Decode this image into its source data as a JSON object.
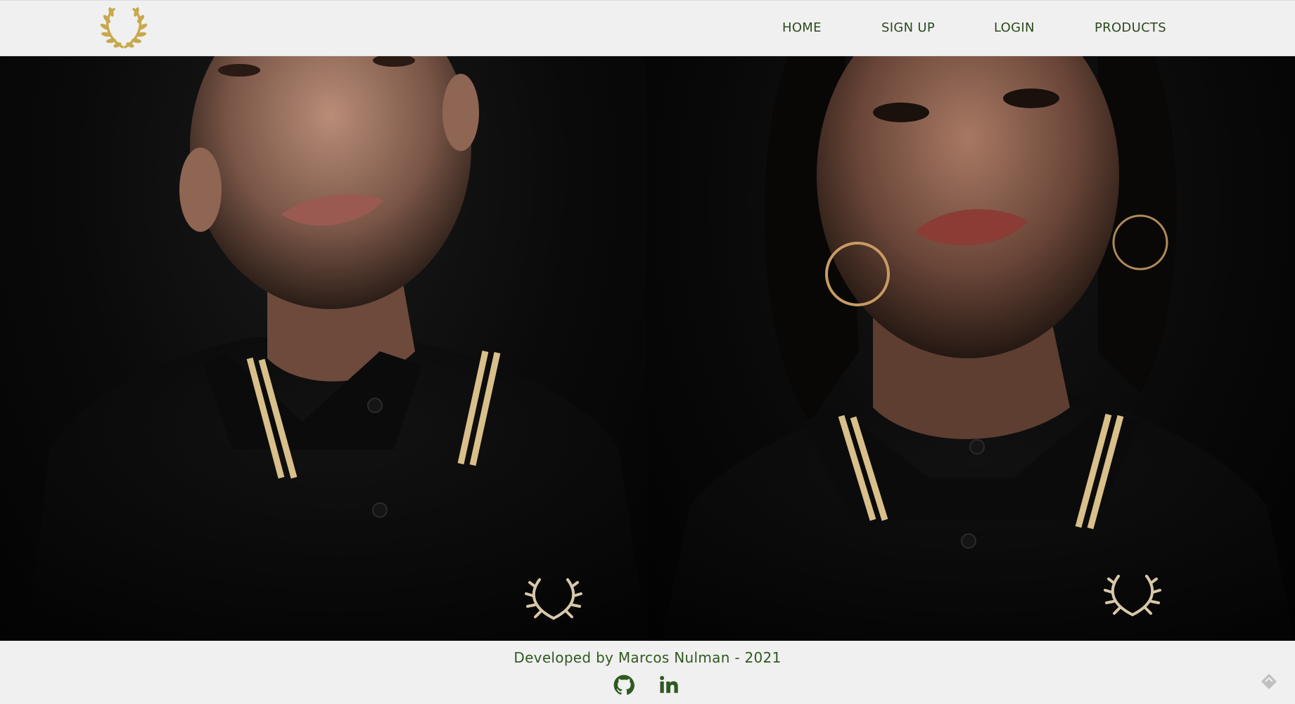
{
  "header": {
    "logo_icon": "laurel-wreath-icon",
    "nav": [
      {
        "label": "HOME"
      },
      {
        "label": "SIGN UP"
      },
      {
        "label": "LOGIN"
      },
      {
        "label": "PRODUCTS"
      }
    ]
  },
  "hero": {
    "images": [
      {
        "subject": "man-in-black-polo-photo"
      },
      {
        "subject": "woman-in-black-polo-photo"
      }
    ]
  },
  "footer": {
    "credit": "Developed by Marcos Nulman - 2021",
    "social": [
      {
        "icon": "github-icon"
      },
      {
        "icon": "linkedin-icon"
      }
    ]
  },
  "colors": {
    "nav_text": "#2c4a1d",
    "footer_text": "#2f5a1f",
    "logo_gold": "#c8a84c",
    "background": "#f0f0f0"
  }
}
